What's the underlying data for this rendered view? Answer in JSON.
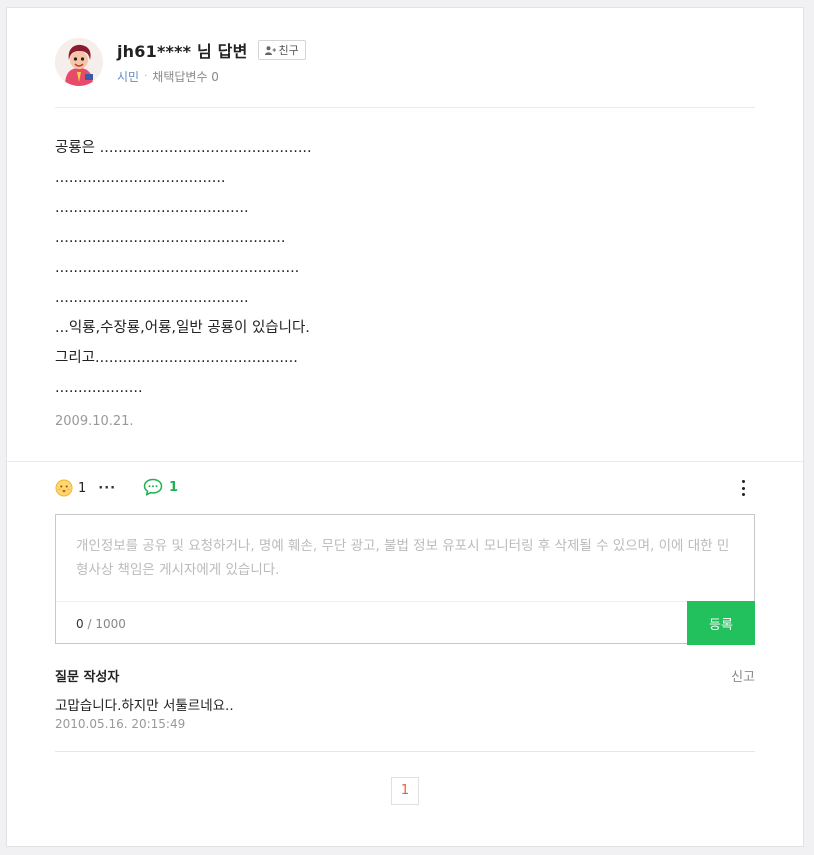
{
  "author": {
    "name": "jh61**** 님 답변",
    "friend_label": "친구",
    "grade": "시민",
    "separator": "·",
    "adopted_label": "채택답변수 0"
  },
  "answer": {
    "lines": [
      "공룡은 ..............................................",
      ".....................................",
      "..........................................",
      "..................................................",
      ".....................................................",
      "..........................................",
      "...익룡,수장룡,어룡,일반 공룡이 있습니다.",
      "그리고............................................",
      "..................."
    ],
    "date": "2009.10.21."
  },
  "actions": {
    "reaction_count": "1",
    "reaction_more": "···",
    "comment_count": "1"
  },
  "comment_form": {
    "placeholder": "개인정보를 공유 및 요청하거나, 명예 훼손, 무단 광고, 불법 정보 유포시 모니터링 후 삭제될 수 있으며, 이에 대한 민형사상 책임은 게시자에게 있습니다.",
    "count_current": "0",
    "count_max": " / 1000",
    "submit_label": "등록"
  },
  "comment": {
    "author": "질문 작성자",
    "report_label": "신고",
    "text": "고맙습니다.하지만 서툴르네요..",
    "time": "2010.05.16. 20:15:49"
  },
  "pagination": {
    "current_page": "1"
  },
  "colors": {
    "accent_green": "#22c15d",
    "grade_blue": "#5e8cc8",
    "page_orange": "#e6613d"
  }
}
